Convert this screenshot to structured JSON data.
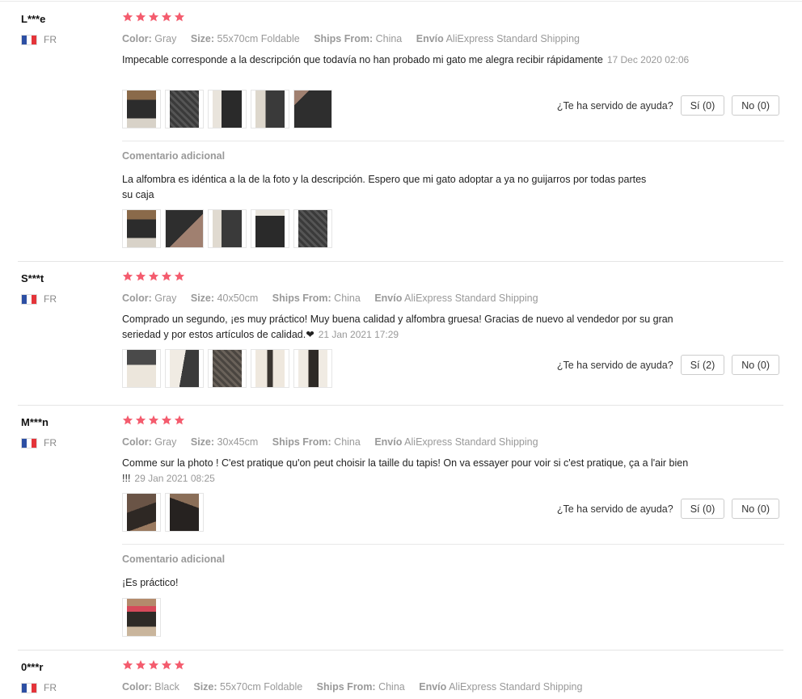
{
  "colors": {
    "star": "#f45c6e",
    "muted": "#999999",
    "border": "#e5e5e5"
  },
  "reviews": [
    {
      "user": "L***e",
      "country": "FR",
      "stars": 5,
      "specs": [
        {
          "key": "Color:",
          "value": "Gray"
        },
        {
          "key": "Size:",
          "value": "55x70cm Foldable"
        },
        {
          "key": "Ships From:",
          "value": "China"
        },
        {
          "key": "Envío",
          "value": "AliExpress Standard Shipping"
        }
      ],
      "text": "Impecable corresponde a la descripción que todavía no han probado mi gato me alegra recibir rápidamente",
      "date": "17 Dec 2020 02:06",
      "help_label": "¿Te ha servido de ayuda?",
      "yes_label": "Sí (0)",
      "no_label": "No (0)",
      "additional": {
        "title": "Comentario adicional",
        "text": "La alfombra es idéntica a la de la foto y la descripción. Espero que mi gato adoptar a ya no guijarros por todas partes su caja"
      }
    },
    {
      "user": "S***t",
      "country": "FR",
      "stars": 5,
      "specs": [
        {
          "key": "Color:",
          "value": "Gray"
        },
        {
          "key": "Size:",
          "value": "40x50cm"
        },
        {
          "key": "Ships From:",
          "value": "China"
        },
        {
          "key": "Envío",
          "value": "AliExpress Standard Shipping"
        }
      ],
      "text": "Comprado un segundo, ¡es muy práctico! Muy buena calidad y alfombra gruesa! Gracias de nuevo al vendedor por su gran seriedad y por estos artículos de calidad.❤",
      "date": "21 Jan 2021 17:29",
      "help_label": "¿Te ha servido de ayuda?",
      "yes_label": "Sí (2)",
      "no_label": "No (0)"
    },
    {
      "user": "M***n",
      "country": "FR",
      "stars": 5,
      "specs": [
        {
          "key": "Color:",
          "value": "Gray"
        },
        {
          "key": "Size:",
          "value": "30x45cm"
        },
        {
          "key": "Ships From:",
          "value": "China"
        },
        {
          "key": "Envío",
          "value": "AliExpress Standard Shipping"
        }
      ],
      "text": "Comme sur la photo ! C'est pratique qu'on peut choisir la taille du tapis! On va essayer pour voir si c'est pratique, ça a l'air bien !!!",
      "date": "29 Jan 2021 08:25",
      "help_label": "¿Te ha servido de ayuda?",
      "yes_label": "Sí (0)",
      "no_label": "No (0)",
      "additional": {
        "title": "Comentario adicional",
        "text": "¡Es práctico!"
      }
    },
    {
      "user": "0***r",
      "country": "FR",
      "stars": 5,
      "specs": [
        {
          "key": "Color:",
          "value": "Black"
        },
        {
          "key": "Size:",
          "value": "55x70cm Foldable"
        },
        {
          "key": "Ships From:",
          "value": "China"
        },
        {
          "key": "Envío",
          "value": "AliExpress Standard Shipping"
        }
      ]
    }
  ]
}
